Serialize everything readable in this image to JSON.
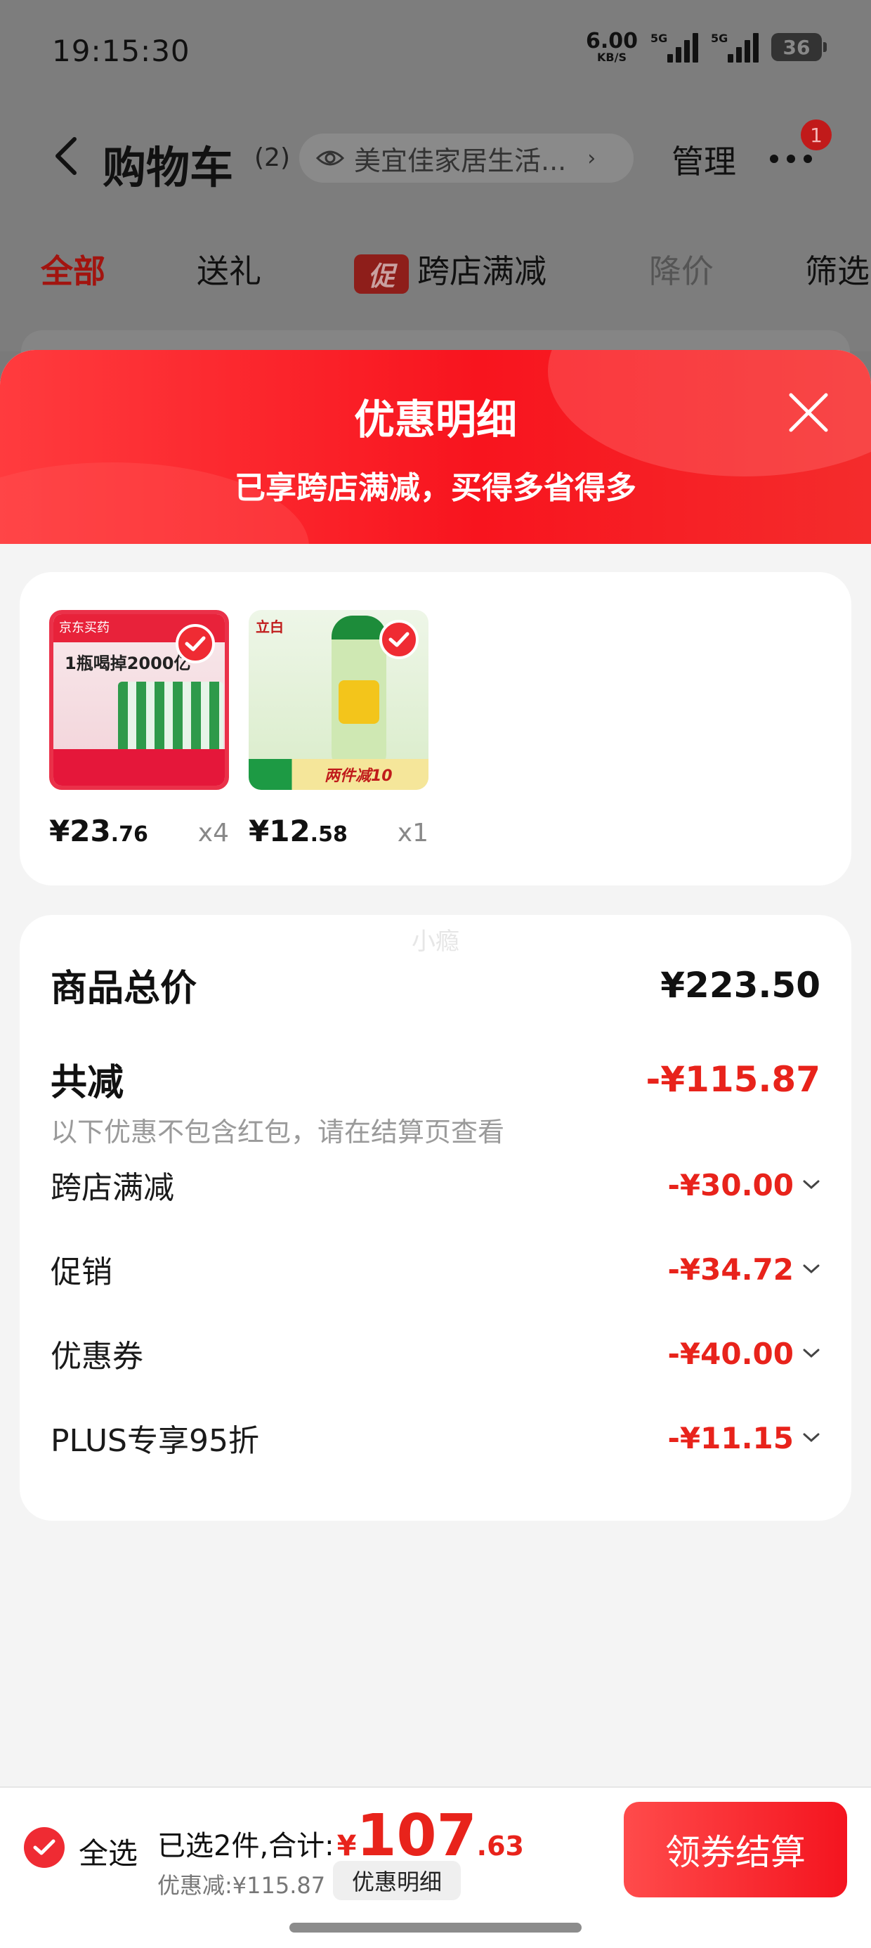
{
  "status_bar": {
    "time": "19:15:30",
    "net_speed": "6.00",
    "net_unit": "KB/S",
    "signal1_label": "5G",
    "signal2_label": "5G",
    "battery": "36"
  },
  "nav": {
    "title": "购物车",
    "count": "(2)",
    "store": "美宜佳家居生活...",
    "manage": "管理",
    "badge": "1"
  },
  "filter_tabs": {
    "all": "全部",
    "gift": "送礼",
    "promo_tag": "促",
    "cross_store": "跨店满减",
    "price_drop": "降价",
    "filter": "筛选"
  },
  "sheet": {
    "title": "优惠明细",
    "subtitle": "已享跨店满减，买得多省得多"
  },
  "products": [
    {
      "price_int": "¥23",
      "price_dec": ".76",
      "qty": "x4",
      "brand": "京东买药",
      "headline": "1瓶喝掉2000亿"
    },
    {
      "price_int": "¥12",
      "price_dec": ".58",
      "qty": "x1",
      "brand": "立白",
      "ribbon": "两件减10"
    }
  ],
  "summary": {
    "watermark": "小瘾",
    "total_label": "商品总价",
    "total_value": "¥223.50",
    "reduce_label": "共减",
    "reduce_value": "-¥115.87",
    "note": "以下优惠不包含红包，请在结算页查看",
    "details": [
      {
        "label": "跨店满减",
        "value": "-¥30.00"
      },
      {
        "label": "促销",
        "value": "-¥34.72"
      },
      {
        "label": "优惠券",
        "value": "-¥40.00"
      },
      {
        "label": "PLUS专享95折",
        "value": "-¥11.15"
      }
    ]
  },
  "bottom": {
    "select_all": "全选",
    "selected_text": "已选2件,合计:",
    "yen": "¥",
    "total_int": "107",
    "total_dec": ".63",
    "discount": "优惠减:¥115.87",
    "detail_button": "优惠明细",
    "checkout": "领券结算"
  },
  "colors": {
    "accent_red": "#e8231b",
    "header_red": "#f8141e",
    "overlay_gray": "#7d7d7d"
  }
}
